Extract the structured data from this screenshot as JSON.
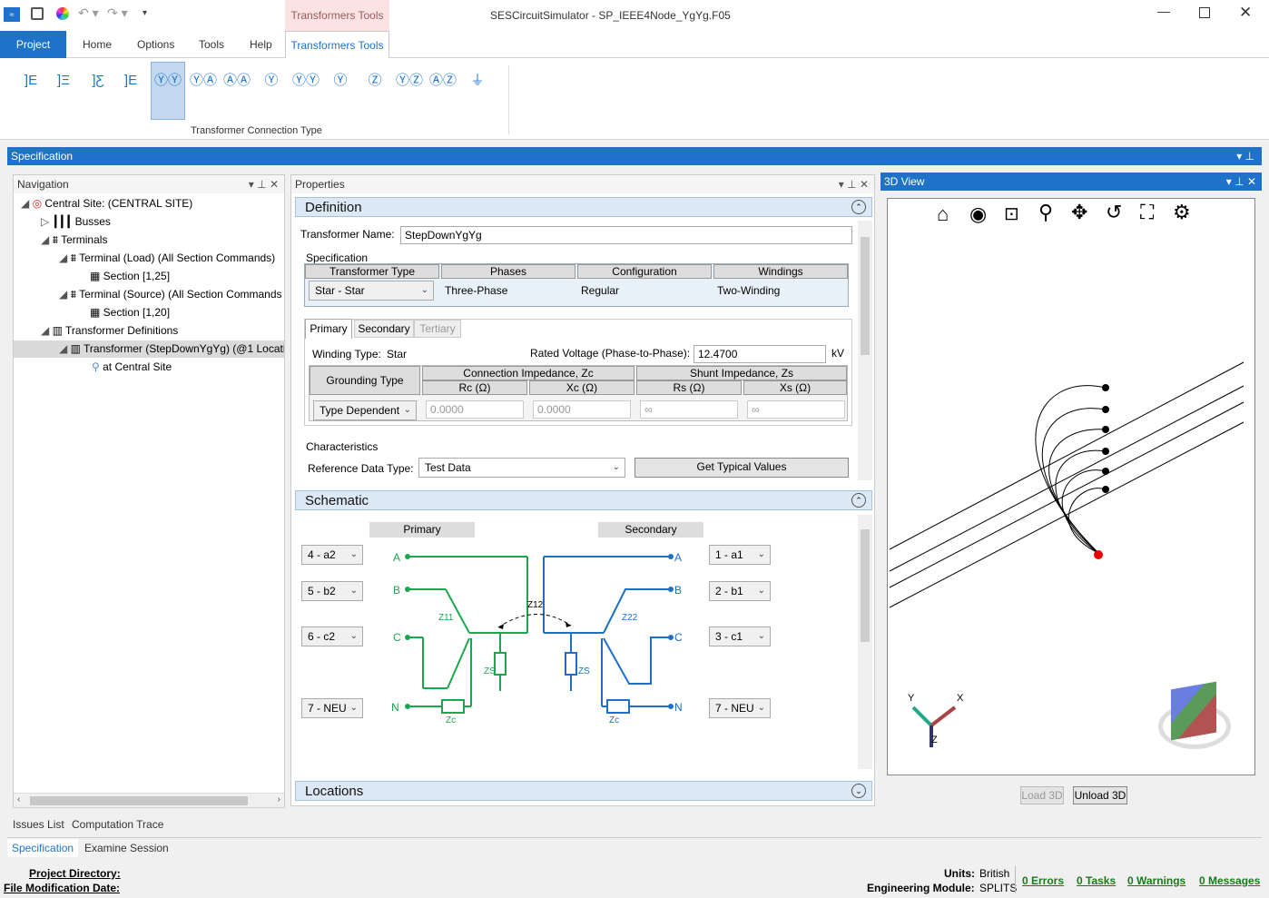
{
  "app": {
    "title": "SESCircuitSimulator - SP_IEEE4Node_YgYg.F05",
    "context_tab_header": "Transformers Tools"
  },
  "ribbon": {
    "tabs": [
      "Project",
      "Home",
      "Options",
      "Tools",
      "Help",
      "Transformers Tools"
    ],
    "group_label": "Transformer Connection Type"
  },
  "spec_panel": {
    "title": "Specification"
  },
  "navigation": {
    "title": "Navigation",
    "items": [
      "Central Site: (CENTRAL SITE)",
      "Busses",
      "Terminals",
      "Terminal (Load) (All Section Commands)",
      "Section [1,25]",
      "Terminal (Source) (All Section Commands",
      "Section [1,20]",
      "Transformer Definitions",
      "Transformer (StepDownYgYg) (@1 Locati",
      "at Central Site"
    ]
  },
  "properties": {
    "title": "Properties",
    "definition": {
      "title": "Definition",
      "name_label": "Transformer Name:",
      "name_value": "StepDownYgYg",
      "spec_label": "Specification",
      "columns": [
        "Transformer Type",
        "Phases",
        "Configuration",
        "Windings"
      ],
      "type_value": "Star - Star",
      "phases": "Three-Phase",
      "configuration": "Regular",
      "windings": "Two-Winding",
      "subtabs": [
        "Primary",
        "Secondary",
        "Tertiary"
      ],
      "winding_type_label": "Winding Type:",
      "winding_type_value": "Star",
      "rated_voltage_label": "Rated Voltage (Phase-to-Phase):",
      "rated_voltage_value": "12.4700",
      "rated_voltage_unit": "kV",
      "grounding_type_label": "Grounding Type",
      "conn_imp_label": "Connection Impedance, Zc",
      "shunt_imp_label": "Shunt Impedance, Zs",
      "rc": "Rc (Ω)",
      "xc": "Xc (Ω)",
      "rs": "Rs (Ω)",
      "xs": "Xs (Ω)",
      "grounding_value": "Type Dependent",
      "rc_value": "0.0000",
      "xc_value": "0.0000",
      "rs_value": "∞",
      "xs_value": "∞",
      "characteristics_label": "Characteristics",
      "ref_type_label": "Reference Data Type:",
      "ref_type_value": "Test Data",
      "typical_button": "Get Typical Values"
    },
    "schematic": {
      "title": "Schematic",
      "primary": "Primary",
      "secondary": "Secondary",
      "left_combos": [
        "4 - a2",
        "5 - b2",
        "6 - c2",
        "7 - NEU"
      ],
      "right_combos": [
        "1 - a1",
        "2 - b1",
        "3 - c1",
        "7 - NEU"
      ],
      "labels_left": [
        "A",
        "B",
        "C",
        "N"
      ],
      "labels_right": [
        "A",
        "B",
        "C",
        "N"
      ],
      "z11": "Z11",
      "z12": "Z12",
      "z22": "Z22",
      "zs": "ZS",
      "zc": "Zc"
    },
    "locations": {
      "title": "Locations"
    }
  },
  "view3d": {
    "title": "3D View",
    "axis_x": "X",
    "axis_y": "Y",
    "axis_z": "Z",
    "load_button": "Load 3D",
    "unload_button": "Unload 3D"
  },
  "bottom_tabs": {
    "row1": [
      "Issues List",
      "Computation Trace"
    ],
    "row2": [
      "Specification",
      "Examine Session"
    ]
  },
  "statusbar": {
    "project_dir": "Project Directory:",
    "file_mod": "File Modification Date:",
    "units_label": "Units:",
    "units_value": "British",
    "module_label": "Engineering Module:",
    "module_value": "SPLITS",
    "errors": "0 Errors",
    "tasks": "0 Tasks",
    "warnings": "0 Warnings",
    "messages": "0 Messages"
  },
  "colors": {
    "accent": "#1e73c8",
    "primary_green": "#1aa84e",
    "secondary_blue": "#1e6fc8"
  }
}
